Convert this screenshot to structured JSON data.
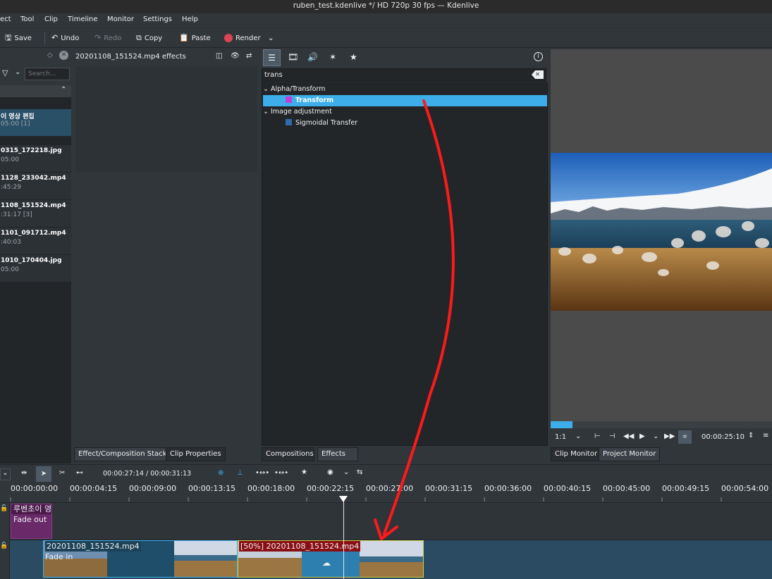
{
  "window": {
    "title": "ruben_test.kdenlive */ HD 720p 30 fps — Kdenlive"
  },
  "menu": [
    "ect",
    "Tool",
    "Clip",
    "Timeline",
    "Monitor",
    "Settings",
    "Help"
  ],
  "toolbar": {
    "save": "Save",
    "undo": "Undo",
    "redo": "Redo",
    "copy": "Copy",
    "paste": "Paste",
    "render": "Render"
  },
  "bin": {
    "search_placeholder": "Search...",
    "items": [
      {
        "name": "이 영상 편집",
        "detail": "05:00 [1]"
      },
      {
        "name": "0315_172218.jpg",
        "detail": "05:00"
      },
      {
        "name": "1128_233042.mp4",
        "detail": ":45:29"
      },
      {
        "name": "1108_151524.mp4",
        "detail": ":31:17 [3]"
      },
      {
        "name": "1101_091712.mp4",
        "detail": ":40:03"
      },
      {
        "name": "1010_170404.jpg",
        "detail": "05:00"
      }
    ]
  },
  "effect_stack": {
    "title": "20201108_151524.mp4 effects"
  },
  "effects": {
    "search_value": "trans",
    "groups": [
      {
        "name": "Alpha/Transform",
        "items": [
          "Transform"
        ]
      },
      {
        "name": "Image adjustment",
        "items": [
          "Sigmoidal Transfer"
        ]
      }
    ],
    "selected": "Transform"
  },
  "tabs": {
    "left": [
      "Effect/Composition Stack",
      "Clip Properties"
    ],
    "middle": [
      "Compositions",
      "Effects"
    ],
    "right": [
      "Clip Monitor",
      "Project Monitor"
    ]
  },
  "monitor": {
    "zoom": "1:1",
    "timecode": "00:00:25:10"
  },
  "timeline": {
    "position": "00:00:27:14 / 00:00:31:13",
    "ruler": [
      "00:00:00:00",
      "00:00:04:15",
      "00:00:09:00",
      "00:00:13:15",
      "00:00:18:00",
      "00:00:22:15",
      "00:00:27:00",
      "00:00:31:15",
      "00:00:36:00",
      "00:00:40:15",
      "00:00:45:00",
      "00:00:49:15",
      "00:00:54:00"
    ],
    "clips": {
      "title_clip": {
        "name": "루벤초이 영",
        "label": "Fade out"
      },
      "clip1": {
        "name": "20201108_151524.mp4",
        "label": "Fade in"
      },
      "clip2": {
        "name": "[50%] 20201108_151524.mp4"
      }
    }
  },
  "colors": {
    "accent": "#3daee9",
    "annotation": "#ff1a1a",
    "render": "#da4453"
  }
}
